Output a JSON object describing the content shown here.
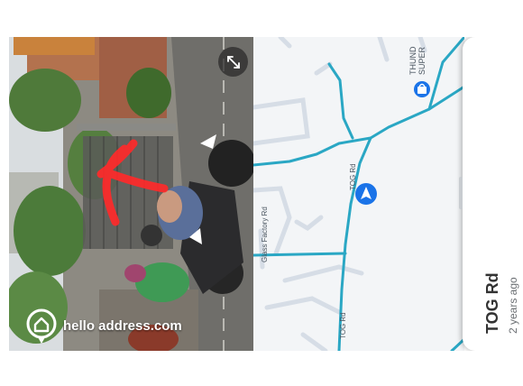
{
  "street_view": {
    "expand_icon": "expand-diagonal-icon",
    "watermark": "hello address.com",
    "watermark_icon": "home-pin-icon",
    "annotation_color": "#ff2a2a"
  },
  "map": {
    "roads": {
      "tog_rd_1": "TOG Rd",
      "tog_rd_2": "TOG Rd",
      "glass_factory_rd": "Glass Factory Rd"
    },
    "poi": {
      "name_line1": "THUND",
      "name_line2": "SUPER"
    },
    "location_icon": "navigation-arrow-icon",
    "poi_icon": "shopping-bag-icon",
    "route_color": "#2aa7c4"
  },
  "place_sheet": {
    "title": "TOG Rd",
    "subtitle": "2 years ago"
  }
}
